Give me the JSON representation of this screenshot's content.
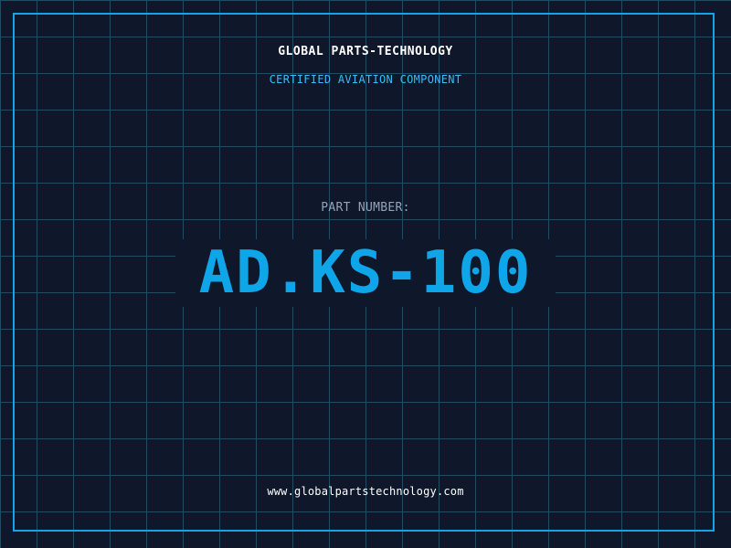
{
  "header": {
    "company": "GLOBAL PARTS-TECHNOLOGY",
    "tagline": "CERTIFIED AVIATION COMPONENT"
  },
  "part": {
    "label": "PART NUMBER:",
    "number": "AD.KS-100"
  },
  "footer": {
    "website": "www.globalpartstechnology.com"
  },
  "colors": {
    "background": "#0f172a",
    "grid": "#1f4d66",
    "accent": "#0ea5e9",
    "tagline": "#38bdf8",
    "label": "#94a3b8",
    "text": "#ffffff"
  }
}
